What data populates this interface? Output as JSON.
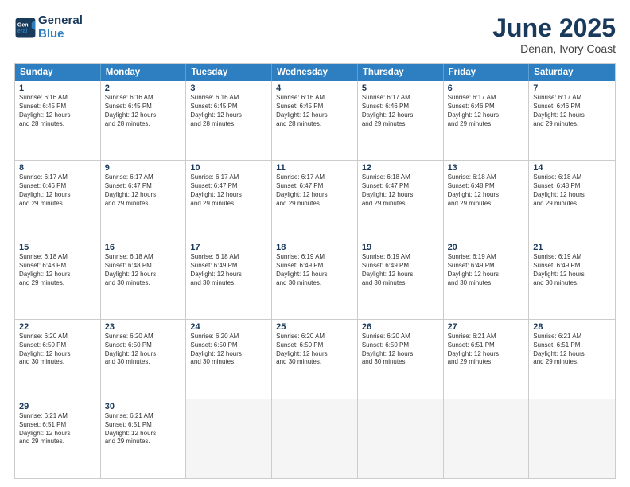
{
  "logo": {
    "line1": "General",
    "line2": "Blue"
  },
  "title": "June 2025",
  "subtitle": "Denan, Ivory Coast",
  "header_days": [
    "Sunday",
    "Monday",
    "Tuesday",
    "Wednesday",
    "Thursday",
    "Friday",
    "Saturday"
  ],
  "weeks": [
    [
      {
        "day": "1",
        "lines": [
          "Sunrise: 6:16 AM",
          "Sunset: 6:45 PM",
          "Daylight: 12 hours",
          "and 28 minutes."
        ]
      },
      {
        "day": "2",
        "lines": [
          "Sunrise: 6:16 AM",
          "Sunset: 6:45 PM",
          "Daylight: 12 hours",
          "and 28 minutes."
        ]
      },
      {
        "day": "3",
        "lines": [
          "Sunrise: 6:16 AM",
          "Sunset: 6:45 PM",
          "Daylight: 12 hours",
          "and 28 minutes."
        ]
      },
      {
        "day": "4",
        "lines": [
          "Sunrise: 6:16 AM",
          "Sunset: 6:45 PM",
          "Daylight: 12 hours",
          "and 28 minutes."
        ]
      },
      {
        "day": "5",
        "lines": [
          "Sunrise: 6:17 AM",
          "Sunset: 6:46 PM",
          "Daylight: 12 hours",
          "and 29 minutes."
        ]
      },
      {
        "day": "6",
        "lines": [
          "Sunrise: 6:17 AM",
          "Sunset: 6:46 PM",
          "Daylight: 12 hours",
          "and 29 minutes."
        ]
      },
      {
        "day": "7",
        "lines": [
          "Sunrise: 6:17 AM",
          "Sunset: 6:46 PM",
          "Daylight: 12 hours",
          "and 29 minutes."
        ]
      }
    ],
    [
      {
        "day": "8",
        "lines": [
          "Sunrise: 6:17 AM",
          "Sunset: 6:46 PM",
          "Daylight: 12 hours",
          "and 29 minutes."
        ]
      },
      {
        "day": "9",
        "lines": [
          "Sunrise: 6:17 AM",
          "Sunset: 6:47 PM",
          "Daylight: 12 hours",
          "and 29 minutes."
        ]
      },
      {
        "day": "10",
        "lines": [
          "Sunrise: 6:17 AM",
          "Sunset: 6:47 PM",
          "Daylight: 12 hours",
          "and 29 minutes."
        ]
      },
      {
        "day": "11",
        "lines": [
          "Sunrise: 6:17 AM",
          "Sunset: 6:47 PM",
          "Daylight: 12 hours",
          "and 29 minutes."
        ]
      },
      {
        "day": "12",
        "lines": [
          "Sunrise: 6:18 AM",
          "Sunset: 6:47 PM",
          "Daylight: 12 hours",
          "and 29 minutes."
        ]
      },
      {
        "day": "13",
        "lines": [
          "Sunrise: 6:18 AM",
          "Sunset: 6:48 PM",
          "Daylight: 12 hours",
          "and 29 minutes."
        ]
      },
      {
        "day": "14",
        "lines": [
          "Sunrise: 6:18 AM",
          "Sunset: 6:48 PM",
          "Daylight: 12 hours",
          "and 29 minutes."
        ]
      }
    ],
    [
      {
        "day": "15",
        "lines": [
          "Sunrise: 6:18 AM",
          "Sunset: 6:48 PM",
          "Daylight: 12 hours",
          "and 29 minutes."
        ]
      },
      {
        "day": "16",
        "lines": [
          "Sunrise: 6:18 AM",
          "Sunset: 6:48 PM",
          "Daylight: 12 hours",
          "and 30 minutes."
        ]
      },
      {
        "day": "17",
        "lines": [
          "Sunrise: 6:18 AM",
          "Sunset: 6:49 PM",
          "Daylight: 12 hours",
          "and 30 minutes."
        ]
      },
      {
        "day": "18",
        "lines": [
          "Sunrise: 6:19 AM",
          "Sunset: 6:49 PM",
          "Daylight: 12 hours",
          "and 30 minutes."
        ]
      },
      {
        "day": "19",
        "lines": [
          "Sunrise: 6:19 AM",
          "Sunset: 6:49 PM",
          "Daylight: 12 hours",
          "and 30 minutes."
        ]
      },
      {
        "day": "20",
        "lines": [
          "Sunrise: 6:19 AM",
          "Sunset: 6:49 PM",
          "Daylight: 12 hours",
          "and 30 minutes."
        ]
      },
      {
        "day": "21",
        "lines": [
          "Sunrise: 6:19 AM",
          "Sunset: 6:49 PM",
          "Daylight: 12 hours",
          "and 30 minutes."
        ]
      }
    ],
    [
      {
        "day": "22",
        "lines": [
          "Sunrise: 6:20 AM",
          "Sunset: 6:50 PM",
          "Daylight: 12 hours",
          "and 30 minutes."
        ]
      },
      {
        "day": "23",
        "lines": [
          "Sunrise: 6:20 AM",
          "Sunset: 6:50 PM",
          "Daylight: 12 hours",
          "and 30 minutes."
        ]
      },
      {
        "day": "24",
        "lines": [
          "Sunrise: 6:20 AM",
          "Sunset: 6:50 PM",
          "Daylight: 12 hours",
          "and 30 minutes."
        ]
      },
      {
        "day": "25",
        "lines": [
          "Sunrise: 6:20 AM",
          "Sunset: 6:50 PM",
          "Daylight: 12 hours",
          "and 30 minutes."
        ]
      },
      {
        "day": "26",
        "lines": [
          "Sunrise: 6:20 AM",
          "Sunset: 6:50 PM",
          "Daylight: 12 hours",
          "and 30 minutes."
        ]
      },
      {
        "day": "27",
        "lines": [
          "Sunrise: 6:21 AM",
          "Sunset: 6:51 PM",
          "Daylight: 12 hours",
          "and 29 minutes."
        ]
      },
      {
        "day": "28",
        "lines": [
          "Sunrise: 6:21 AM",
          "Sunset: 6:51 PM",
          "Daylight: 12 hours",
          "and 29 minutes."
        ]
      }
    ],
    [
      {
        "day": "29",
        "lines": [
          "Sunrise: 6:21 AM",
          "Sunset: 6:51 PM",
          "Daylight: 12 hours",
          "and 29 minutes."
        ]
      },
      {
        "day": "30",
        "lines": [
          "Sunrise: 6:21 AM",
          "Sunset: 6:51 PM",
          "Daylight: 12 hours",
          "and 29 minutes."
        ]
      },
      {
        "day": "",
        "lines": []
      },
      {
        "day": "",
        "lines": []
      },
      {
        "day": "",
        "lines": []
      },
      {
        "day": "",
        "lines": []
      },
      {
        "day": "",
        "lines": []
      }
    ]
  ]
}
